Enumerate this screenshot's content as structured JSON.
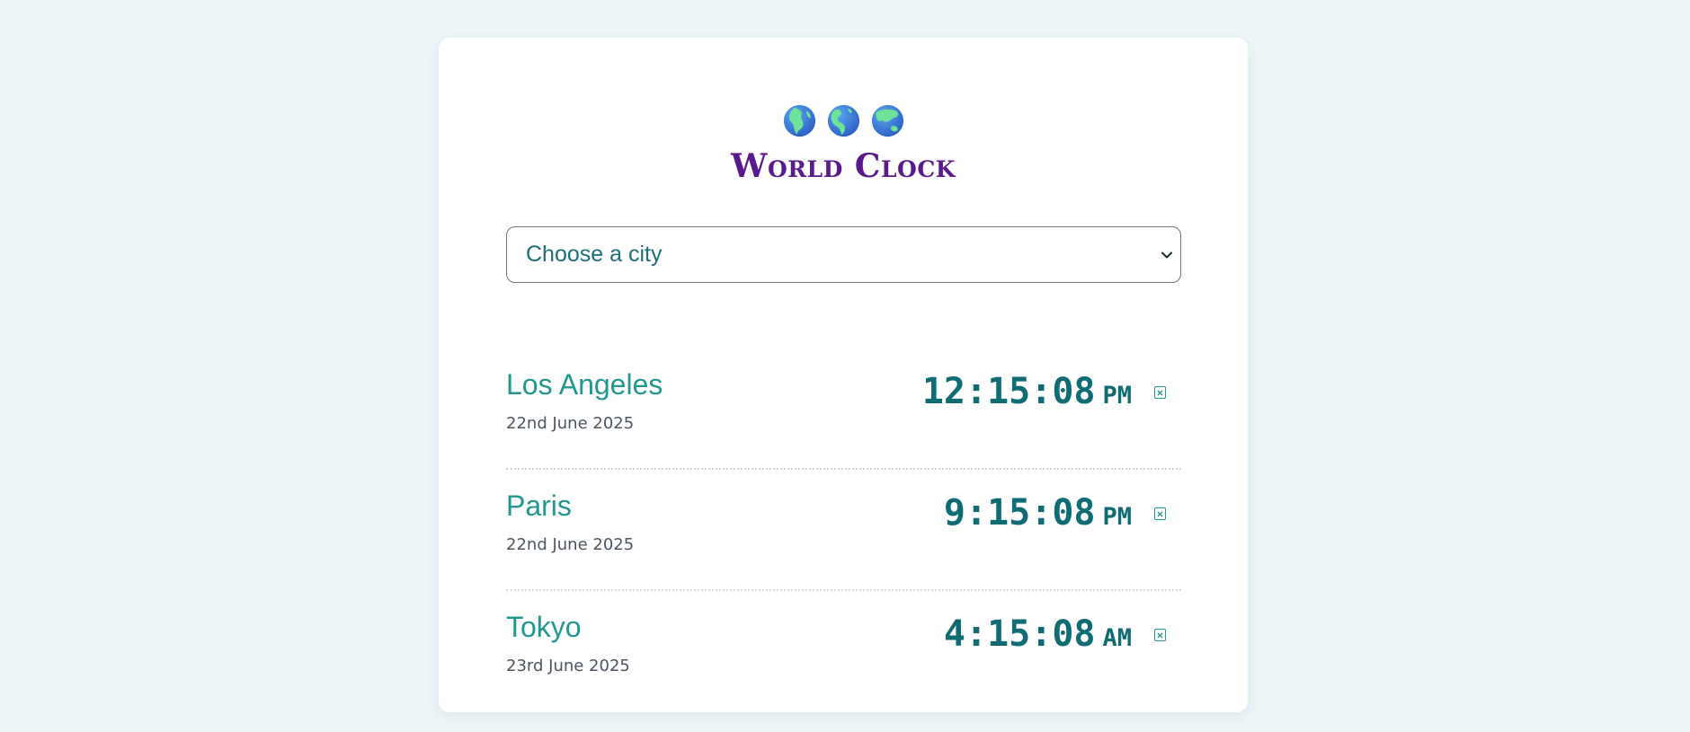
{
  "header": {
    "globe_icons": [
      "globe-europe-africa-icon",
      "globe-americas-icon",
      "globe-asia-australia-icon"
    ],
    "title": "World Clock"
  },
  "city_select": {
    "selected": "Choose a city"
  },
  "cities": [
    {
      "name": "Los Angeles",
      "date": "22nd June 2025",
      "time": "12:15:08",
      "period": "PM"
    },
    {
      "name": "Paris",
      "date": "22nd June 2025",
      "time": "9:15:08",
      "period": "PM"
    },
    {
      "name": "Tokyo",
      "date": "23rd June 2025",
      "time": "4:15:08",
      "period": "AM"
    }
  ],
  "colors": {
    "background": "#ecf5f8",
    "title": "#5a1a8c",
    "city_name": "#22978f",
    "time": "#0f6b74"
  }
}
